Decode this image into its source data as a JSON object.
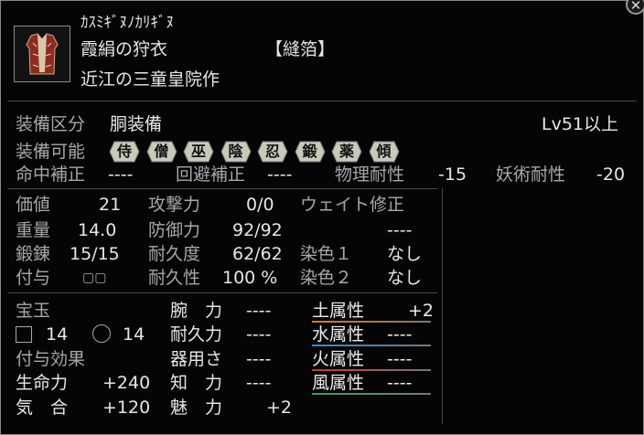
{
  "item": {
    "reading": "ｶｽﾐｷﾞﾇﾉｶﾘｷﾞﾇ",
    "name": "霞絹の狩衣",
    "category_tag": "【縫箔】",
    "maker": "近江の三童皇院作",
    "icon": "robe-armor-icon"
  },
  "equip": {
    "slot_label": "装備区分",
    "slot_value": "胴装備",
    "level_req": "Lv51以上",
    "classes_label": "装備可能",
    "classes": [
      "侍",
      "僧",
      "巫",
      "陰",
      "忍",
      "鍛",
      "薬",
      "傾"
    ]
  },
  "mods": {
    "hit_label": "命中補正",
    "hit_value": "----",
    "evade_label": "回避補正",
    "evade_value": "----",
    "phys_label": "物理耐性",
    "phys_value": "-15",
    "magic_label": "妖術耐性",
    "magic_value": "-20"
  },
  "stats": {
    "value_label": "価値",
    "value": "21",
    "attack_label": "攻撃力",
    "attack": "0/0",
    "weight_label": "重量",
    "weight": "14.0",
    "defense_label": "防御力",
    "defense": "92/92",
    "weight_mod_label": "ウェイト修正",
    "weight_mod": "----",
    "forge_label": "鍛錬",
    "forge": "15/15",
    "durability_label": "耐久度",
    "durability": "62/62",
    "dye1_label": "染色１",
    "dye1": "なし",
    "grant_label": "付与",
    "grant_slots": "▢▢",
    "durability_rate_label": "耐久性",
    "durability_rate": "100 %",
    "dye2_label": "染色２",
    "dye2": "なし"
  },
  "gems": {
    "label": "宝玉",
    "square_count": "14",
    "circle_count": "14",
    "effects_label": "付与効果",
    "hp_label": "生命力",
    "hp": "+240",
    "ki_label": "気　合",
    "ki": "+120"
  },
  "attrs": {
    "arm_label": "腕　力",
    "arm": "----",
    "endurance_label": "耐久力",
    "endurance": "----",
    "dex_label": "器用さ",
    "dex": "----",
    "int_label": "知　力",
    "int": "----",
    "charm_label": "魅　力",
    "charm": "+2"
  },
  "elements": {
    "earth_label": "土属性",
    "earth": "+2",
    "earth_color": "#d87a2a",
    "water_label": "水属性",
    "water": "----",
    "water_color": "#3a8ac8",
    "fire_label": "火属性",
    "fire": "----",
    "fire_color": "#c83a2a",
    "wind_label": "風属性",
    "wind": "----",
    "wind_color": "#3aa060"
  }
}
